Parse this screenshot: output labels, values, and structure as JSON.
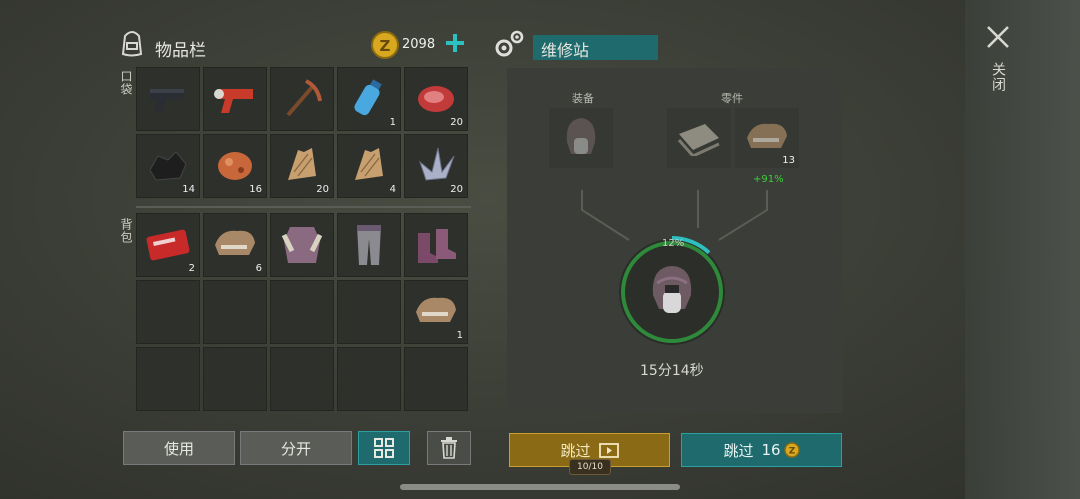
{
  "inventory": {
    "title": "物品栏",
    "currency": "2098",
    "pocket_label": "口袋",
    "backpack_label": "背包",
    "pocket_slots": [
      {
        "item": "pistol-icon",
        "qty": ""
      },
      {
        "item": "flare-gun-icon",
        "qty": ""
      },
      {
        "item": "pickaxe-icon",
        "qty": ""
      },
      {
        "item": "water-bottle-icon",
        "qty": "1"
      },
      {
        "item": "raw-meat-icon",
        "qty": "20"
      },
      {
        "item": "coal-icon",
        "qty": "14"
      },
      {
        "item": "copper-ore-icon",
        "qty": "16"
      },
      {
        "item": "fiber-icon",
        "qty": "20"
      },
      {
        "item": "fiber-icon",
        "qty": "4"
      },
      {
        "item": "crystal-icon",
        "qty": "20"
      }
    ],
    "backpack_slots": [
      {
        "item": "coupon-icon",
        "qty": "2"
      },
      {
        "item": "fur-pelt-icon",
        "qty": "6"
      },
      {
        "item": "armor-vest-icon",
        "qty": ""
      },
      {
        "item": "pants-icon",
        "qty": ""
      },
      {
        "item": "boots-icon",
        "qty": ""
      },
      {
        "item": "",
        "qty": ""
      },
      {
        "item": "",
        "qty": ""
      },
      {
        "item": "",
        "qty": ""
      },
      {
        "item": "",
        "qty": ""
      },
      {
        "item": "fur-pelt-icon",
        "qty": "1"
      },
      {
        "item": "",
        "qty": ""
      },
      {
        "item": "",
        "qty": ""
      },
      {
        "item": "",
        "qty": ""
      },
      {
        "item": "",
        "qty": ""
      },
      {
        "item": "",
        "qty": ""
      }
    ],
    "buttons": {
      "use": "使用",
      "split": "分开"
    }
  },
  "repair": {
    "title": "维修站",
    "equipment_label": "装备",
    "parts_label": "零件",
    "part_qty": "13",
    "part_bonus": "+91%",
    "progress_percent_label": "12%",
    "progress": 0.12,
    "time_left": "15分14秒",
    "skip_ad_label": "跳过",
    "ad_counter": "10/10",
    "skip_coin_label": "跳过",
    "skip_coin_cost": "16"
  },
  "close": {
    "label": "关闭"
  },
  "colors": {
    "teal": "#1f6a6c",
    "gold": "#8a6a15",
    "green": "#2e8a3a",
    "accent_cyan": "#2cc0c0"
  }
}
